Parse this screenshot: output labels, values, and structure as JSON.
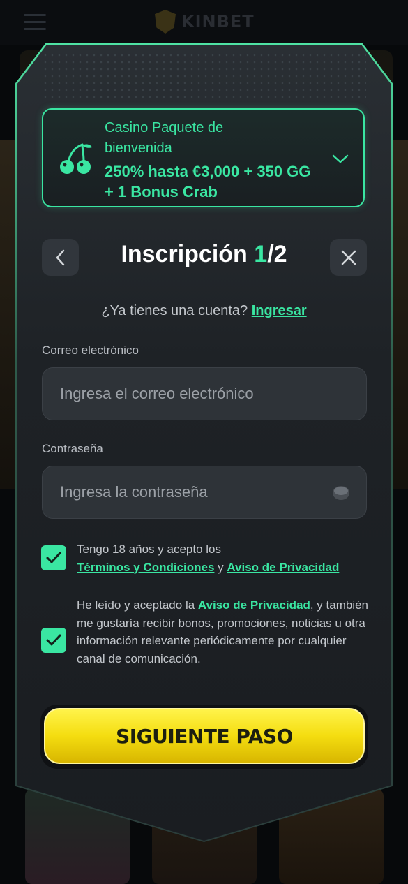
{
  "header": {
    "logo_text": "KINBET"
  },
  "promo": {
    "title": "Casino Paquete de bienvenida",
    "offer": "250% hasta €3,000 + 350 GG + 1 Bonus Crab",
    "icon": "cherry-icon",
    "expand_icon": "chevron-down-icon"
  },
  "modal": {
    "title_prefix": "Inscripción ",
    "step_current": "1",
    "step_total": "/2",
    "back_icon": "chevron-left-icon",
    "close_icon": "close-icon"
  },
  "login_prompt": {
    "text": "¿Ya tienes una cuenta?",
    "link": "Ingresar"
  },
  "email": {
    "label": "Correo electrónico",
    "placeholder": "Ingresa el correo electrónico",
    "value": ""
  },
  "password": {
    "label": "Contraseña",
    "placeholder": "Ingresa la contraseña",
    "value": "",
    "toggle_icon": "eye-icon"
  },
  "consent_terms": {
    "checked": true,
    "text_before": "Tengo 18 años y acepto los",
    "link_terms": "Términos y Condiciones",
    "and": "y",
    "link_privacy": "Aviso de Privacidad"
  },
  "consent_marketing": {
    "checked": true,
    "text_before": "He leído y aceptado la",
    "link_privacy": "Aviso de Privacidad",
    "text_after": ", y también me gustaría recibir bonos, promociones, noticias u otra información relevante periódicamente por cualquier canal de comunicación."
  },
  "cta": {
    "label": "SIGUIENTE PASO"
  },
  "colors": {
    "accent": "#3ae6a2",
    "cta": "#f4dd10",
    "modal_bg": "#1e2226"
  }
}
